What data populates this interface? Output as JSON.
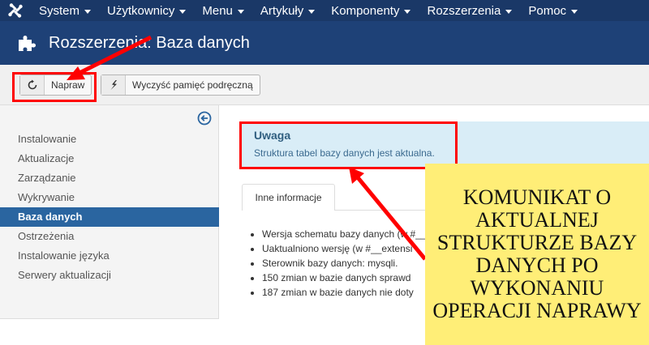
{
  "navbar": {
    "items": [
      {
        "label": "System"
      },
      {
        "label": "Użytkownicy"
      },
      {
        "label": "Menu"
      },
      {
        "label": "Artykuły"
      },
      {
        "label": "Komponenty"
      },
      {
        "label": "Rozszerzenia"
      },
      {
        "label": "Pomoc"
      }
    ]
  },
  "header": {
    "title": "Rozszerzenia: Baza danych",
    "icon": "puzzle-icon"
  },
  "toolbar": {
    "fix_label": "Napraw",
    "fix_icon": "refresh-icon",
    "clear_cache_label": "Wyczyść pamięć podręczną",
    "clear_cache_icon": "flash-icon"
  },
  "sidebar": {
    "collapse_icon": "circle-arrow-left-icon",
    "items": [
      {
        "label": "Instalowanie"
      },
      {
        "label": "Aktualizacje"
      },
      {
        "label": "Zarządzanie"
      },
      {
        "label": "Wykrywanie"
      },
      {
        "label": "Baza danych",
        "active": true
      },
      {
        "label": "Ostrzeżenia"
      },
      {
        "label": "Instalowanie języka"
      },
      {
        "label": "Serwery aktualizacji"
      }
    ]
  },
  "alert": {
    "title": "Uwaga",
    "message": "Struktura tabel bazy danych jest aktualna."
  },
  "tabs": [
    {
      "label": "Inne informacje"
    }
  ],
  "info": {
    "items": [
      "Wersja schematu bazy danych (w #__",
      "Uaktualniono wersję (w #__extensi",
      "Sterownik bazy danych: mysqli.",
      "150 zmian w bazie danych sprawd",
      "187 zmian w bazie danych nie doty"
    ]
  },
  "annotation": {
    "callout_text": "KOMUNIKAT O AKTUALNEJ STRUKTURZE BAZY DANYCH PO WYKONANIU OPERACJI NAPRAWY"
  },
  "colors": {
    "navbar": "#1a3867",
    "header": "#1e4177",
    "active_item": "#2a65a0",
    "alert_bg": "#d9edf7",
    "annotation_red": "#ff0000",
    "callout_bg": "#ffee77"
  }
}
